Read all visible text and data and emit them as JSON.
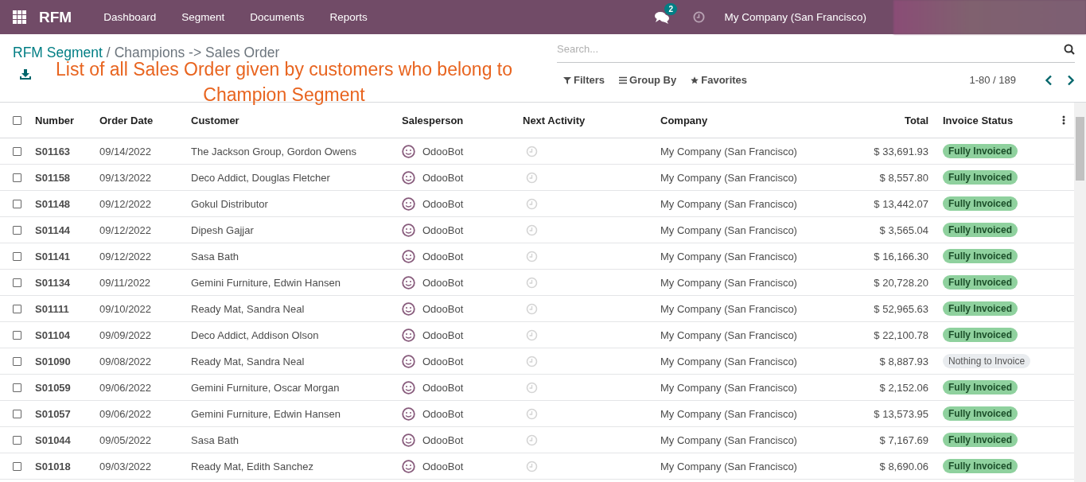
{
  "navbar": {
    "app_name": "RFM",
    "menu": [
      "Dashboard",
      "Segment",
      "Documents",
      "Reports"
    ],
    "message_count": "2",
    "company": "My Company (San Francisco)"
  },
  "breadcrumb": {
    "parent": "RFM Segment",
    "separator": "/",
    "current": "Champions -> Sales Order"
  },
  "annotation": "List of all Sales Order given by customers who belong to Champion Segment",
  "search": {
    "placeholder": "Search..."
  },
  "search_options": [
    "Filters",
    "Group By",
    "Favorites"
  ],
  "pager": "1-80 / 189",
  "table": {
    "all_checked": false,
    "columns": [
      "Number",
      "Order Date",
      "Customer",
      "Salesperson",
      "Next Activity",
      "Company",
      "Total",
      "Invoice Status"
    ],
    "rows": [
      {
        "number": "S01163",
        "date": "09/14/2022",
        "customer": "The Jackson Group, Gordon Owens",
        "salesperson": "OdooBot",
        "company": "My Company (San Francisco)",
        "total": "$ 33,691.93",
        "status": "Fully Invoiced",
        "kind": "invoiced",
        "checked": false
      },
      {
        "number": "S01158",
        "date": "09/13/2022",
        "customer": "Deco Addict, Douglas Fletcher",
        "salesperson": "OdooBot",
        "company": "My Company (San Francisco)",
        "total": "$ 8,557.80",
        "status": "Fully Invoiced",
        "kind": "invoiced",
        "checked": false
      },
      {
        "number": "S01148",
        "date": "09/12/2022",
        "customer": "Gokul Distributor",
        "salesperson": "OdooBot",
        "company": "My Company (San Francisco)",
        "total": "$ 13,442.07",
        "status": "Fully Invoiced",
        "kind": "invoiced",
        "checked": false
      },
      {
        "number": "S01144",
        "date": "09/12/2022",
        "customer": "Dipesh Gajjar",
        "salesperson": "OdooBot",
        "company": "My Company (San Francisco)",
        "total": "$ 3,565.04",
        "status": "Fully Invoiced",
        "kind": "invoiced",
        "checked": false
      },
      {
        "number": "S01141",
        "date": "09/12/2022",
        "customer": "Sasa Bath",
        "salesperson": "OdooBot",
        "company": "My Company (San Francisco)",
        "total": "$ 16,166.30",
        "status": "Fully Invoiced",
        "kind": "invoiced",
        "checked": false
      },
      {
        "number": "S01134",
        "date": "09/11/2022",
        "customer": "Gemini Furniture, Edwin Hansen",
        "salesperson": "OdooBot",
        "company": "My Company (San Francisco)",
        "total": "$ 20,728.20",
        "status": "Fully Invoiced",
        "kind": "invoiced",
        "checked": false
      },
      {
        "number": "S01111",
        "date": "09/10/2022",
        "customer": "Ready Mat, Sandra Neal",
        "salesperson": "OdooBot",
        "company": "My Company (San Francisco)",
        "total": "$ 52,965.63",
        "status": "Fully Invoiced",
        "kind": "invoiced",
        "checked": false
      },
      {
        "number": "S01104",
        "date": "09/09/2022",
        "customer": "Deco Addict, Addison Olson",
        "salesperson": "OdooBot",
        "company": "My Company (San Francisco)",
        "total": "$ 22,100.78",
        "status": "Fully Invoiced",
        "kind": "invoiced",
        "checked": false
      },
      {
        "number": "S01090",
        "date": "09/08/2022",
        "customer": "Ready Mat, Sandra Neal",
        "salesperson": "OdooBot",
        "company": "My Company (San Francisco)",
        "total": "$ 8,887.93",
        "status": "Nothing to Invoice",
        "kind": "nothing",
        "checked": false
      },
      {
        "number": "S01059",
        "date": "09/06/2022",
        "customer": "Gemini Furniture, Oscar Morgan",
        "salesperson": "OdooBot",
        "company": "My Company (San Francisco)",
        "total": "$ 2,152.06",
        "status": "Fully Invoiced",
        "kind": "invoiced",
        "checked": false
      },
      {
        "number": "S01057",
        "date": "09/06/2022",
        "customer": "Gemini Furniture, Edwin Hansen",
        "salesperson": "OdooBot",
        "company": "My Company (San Francisco)",
        "total": "$ 13,573.95",
        "status": "Fully Invoiced",
        "kind": "invoiced",
        "checked": false
      },
      {
        "number": "S01044",
        "date": "09/05/2022",
        "customer": "Sasa Bath",
        "salesperson": "OdooBot",
        "company": "My Company (San Francisco)",
        "total": "$ 7,167.69",
        "status": "Fully Invoiced",
        "kind": "invoiced",
        "checked": false
      },
      {
        "number": "S01018",
        "date": "09/03/2022",
        "customer": "Ready Mat, Edith Sanchez",
        "salesperson": "OdooBot",
        "company": "My Company (San Francisco)",
        "total": "$ 8,690.06",
        "status": "Fully Invoiced",
        "kind": "invoiced",
        "checked": false
      }
    ]
  }
}
